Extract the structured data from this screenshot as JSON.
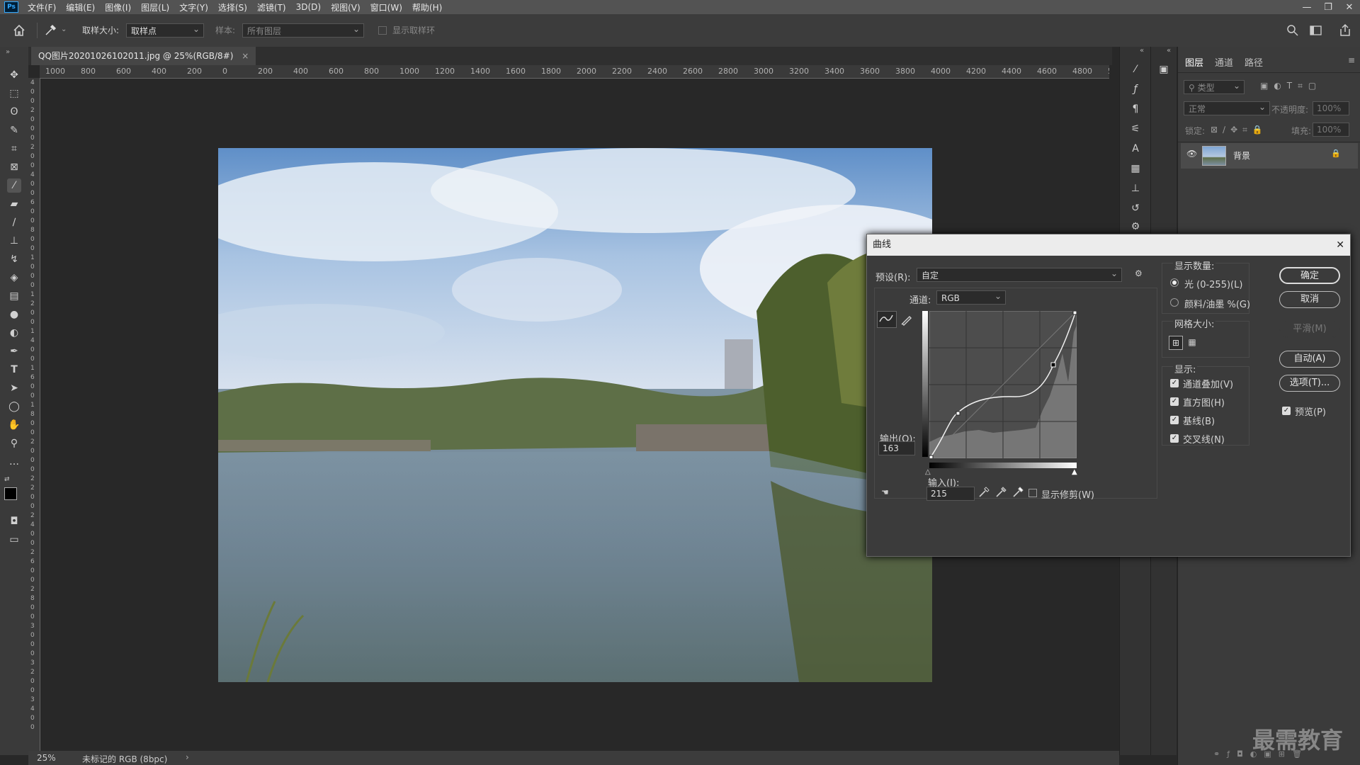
{
  "app": {
    "logo": "Ps"
  },
  "menu": [
    "文件(F)",
    "编辑(E)",
    "图像(I)",
    "图层(L)",
    "文字(Y)",
    "选择(S)",
    "滤镜(T)",
    "3D(D)",
    "视图(V)",
    "窗口(W)",
    "帮助(H)"
  ],
  "window_controls": {
    "minimize": "—",
    "restore": "❐",
    "close": "✕"
  },
  "options": {
    "sample_size_label": "取样大小:",
    "sample_size_value": "取样点",
    "sample_label": "样本:",
    "sample_value": "所有图层",
    "show_ring_label": "显示取样环"
  },
  "document": {
    "tab_title": "QQ图片20201026102011.jpg @ 25%(RGB/8#)",
    "tab_close": "×"
  },
  "ruler_h": [
    "1000",
    "800",
    "600",
    "400",
    "200",
    "0",
    "200",
    "400",
    "600",
    "800",
    "1000",
    "1200",
    "1400",
    "1600",
    "1800",
    "2000",
    "2200",
    "2400",
    "2600",
    "2800",
    "3000",
    "3200",
    "3400",
    "3600",
    "3800",
    "4000",
    "4200",
    "4400",
    "4600",
    "4800",
    "5"
  ],
  "ruler_v": [
    "4",
    "0",
    "0",
    "2",
    "0",
    "0",
    "0",
    "2",
    "0",
    "0",
    "4",
    "0",
    "0",
    "6",
    "0",
    "0",
    "8",
    "0",
    "0",
    "1",
    "0",
    "0",
    "0",
    "1",
    "2",
    "0",
    "0",
    "1",
    "4",
    "0",
    "0",
    "1",
    "6",
    "0",
    "0",
    "1",
    "8",
    "0",
    "0",
    "2",
    "0",
    "0",
    "0",
    "2",
    "2",
    "0",
    "0",
    "2",
    "4",
    "0",
    "0",
    "2",
    "6",
    "0",
    "0",
    "2",
    "8",
    "0",
    "0",
    "3",
    "0",
    "0",
    "0",
    "3",
    "2",
    "0",
    "0",
    "3",
    "4",
    "0",
    "0"
  ],
  "layers_panel": {
    "tabs": [
      "图层",
      "通道",
      "路径"
    ],
    "filter_placeholder": "类型",
    "blend_mode": "正常",
    "opacity_label": "不透明度:",
    "opacity_value": "100%",
    "lock_label": "锁定:",
    "fill_label": "填充:",
    "fill_value": "100%",
    "layer_name": "背景"
  },
  "status": {
    "zoom": "25%",
    "color_profile": "未标记的 RGB (8bpc)",
    "arrow": "›"
  },
  "watermark": "最需教育",
  "curves_dialog": {
    "title": "曲线",
    "close": "✕",
    "preset_label": "预设(R):",
    "preset_value": "自定",
    "channel_label": "通道:",
    "channel_value": "RGB",
    "output_label": "输出(O):",
    "output_value": "163",
    "input_label": "输入(I):",
    "input_value": "215",
    "show_clipping": "显示修剪(W)",
    "show_amount_label": "显示数量:",
    "light_option": "光 (0-255)(L)",
    "pigment_option": "颜料/油墨 %(G)",
    "grid_size_label": "网格大小:",
    "show_label": "显示:",
    "channel_overlays": "通道叠加(V)",
    "histogram": "直方图(H)",
    "baseline": "基线(B)",
    "intersection": "交叉线(N)",
    "ok": "确定",
    "cancel": "取消",
    "smooth": "平滑(M)",
    "auto": "自动(A)",
    "options": "选项(T)...",
    "preview": "预览(P)",
    "check": "✓"
  }
}
